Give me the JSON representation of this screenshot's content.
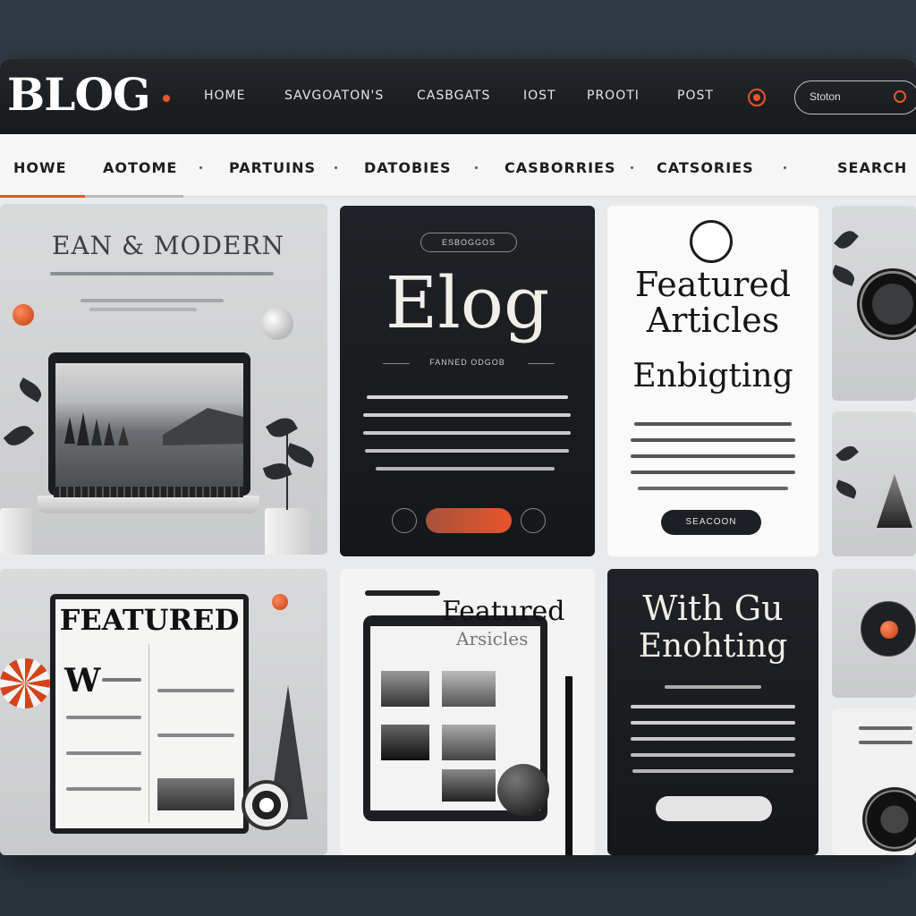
{
  "brand": {
    "logo": "BLOG",
    "accent": "#e8542b"
  },
  "top_nav": [
    "HOME",
    "SAVGOATON'S",
    "CASBGATS",
    "IOST",
    "PROOTI",
    "POST"
  ],
  "top_search": {
    "placeholder": "Stoton",
    "icon": "search-icon"
  },
  "main_nav": {
    "items": [
      "HOWE",
      "AOTOME",
      "PARTUINS",
      "DATOBIES",
      "CASBORRIES",
      "CATSORIES"
    ],
    "search_label": "SEARCH"
  },
  "hero": {
    "headline": "EAN & MODERN"
  },
  "blog_card": {
    "badge": "ESBOGGOS",
    "title": "Elog",
    "subtitle": "FANNED ODGOB"
  },
  "featured_card": {
    "title_line1": "Featured",
    "title_line2": "Articles",
    "title_line3": "Enbigting",
    "button": "SEACOON"
  },
  "magazine": {
    "title": "FEATURED",
    "drop_cap": "W"
  },
  "tablet_card": {
    "title": "Featured",
    "subtitle": "Arsicles"
  },
  "dark_card": {
    "title_line1": "With Gu",
    "title_line2": "Enohting"
  }
}
